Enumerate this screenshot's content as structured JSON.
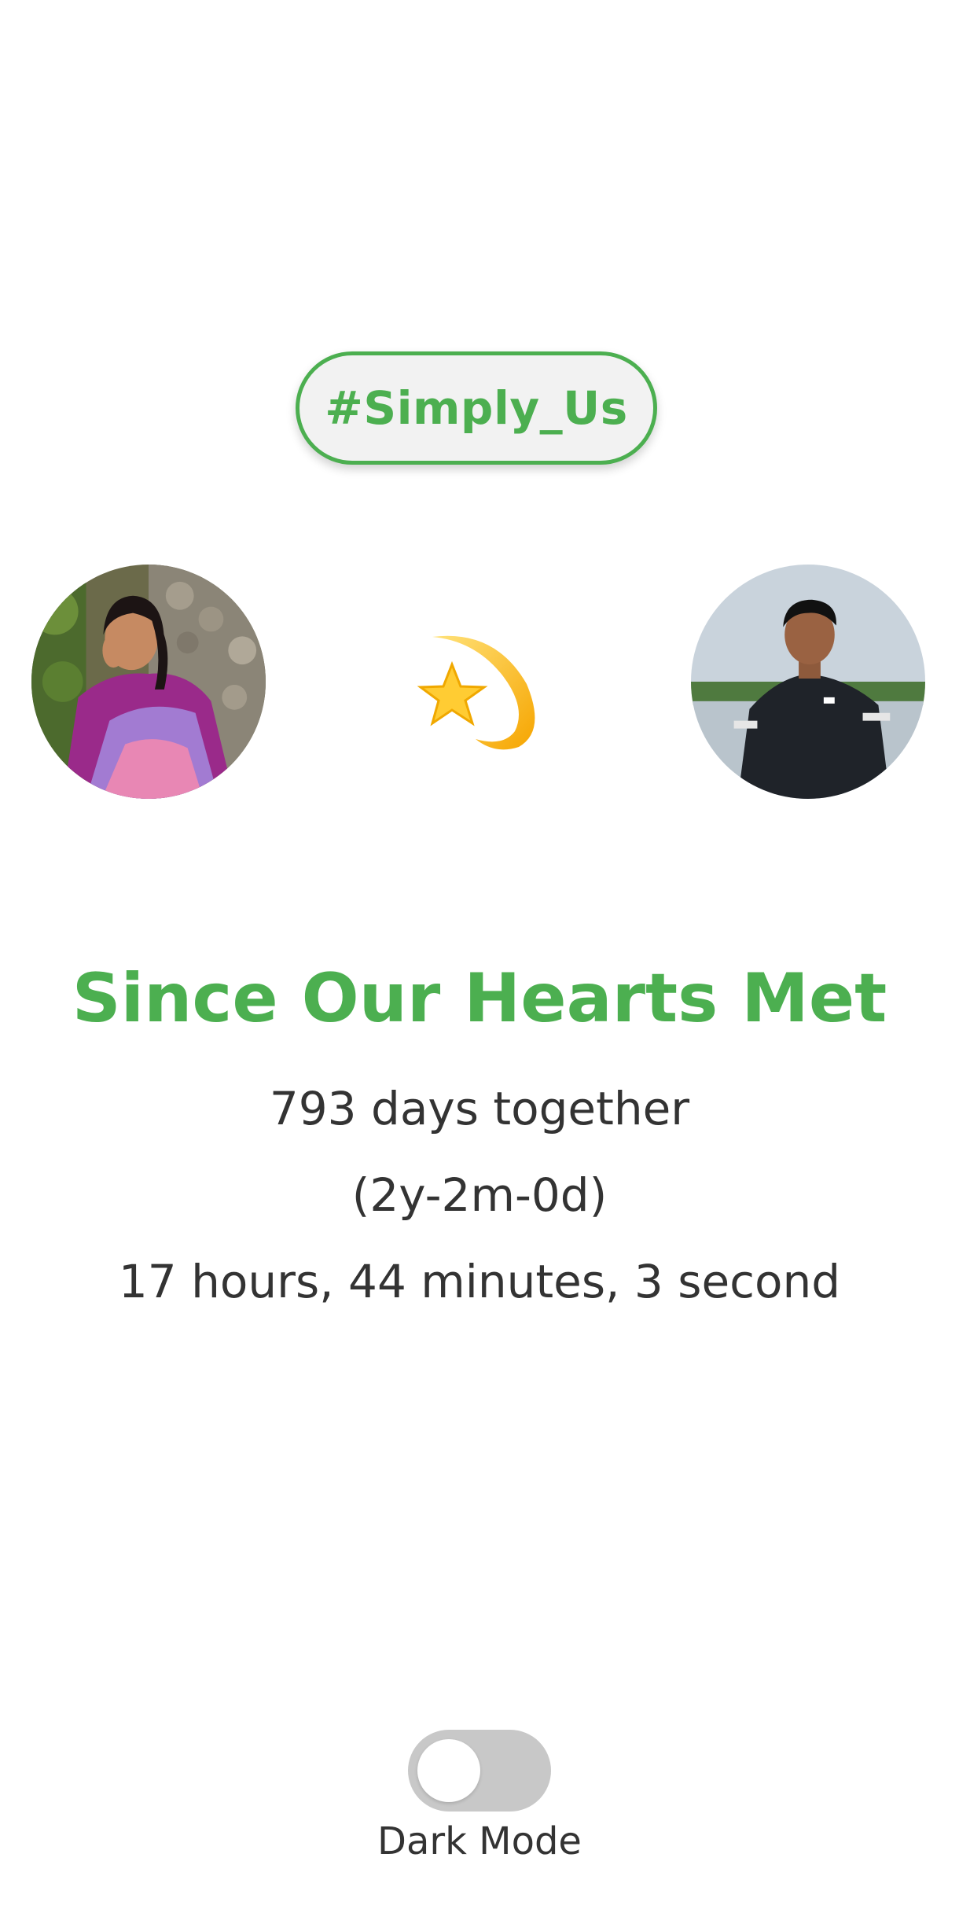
{
  "tag": {
    "label": "#Simply_Us"
  },
  "avatars": {
    "left": {
      "icon": "profile-photo-woman"
    },
    "right": {
      "icon": "profile-photo-man"
    }
  },
  "center_icon": "dizzy-star-icon",
  "headline": "Since Our Hearts Met",
  "counter": {
    "days": "793 days together",
    "ymd": "(2y-2m-0d)",
    "hms": "17 hours, 44 minutes, 3 second"
  },
  "dark_mode": {
    "label": "Dark Mode",
    "enabled": false
  },
  "colors": {
    "accent": "#4caf50",
    "text": "#333333",
    "toggle_track": "#c8c8c8",
    "pill_background": "#f2f2f2"
  }
}
